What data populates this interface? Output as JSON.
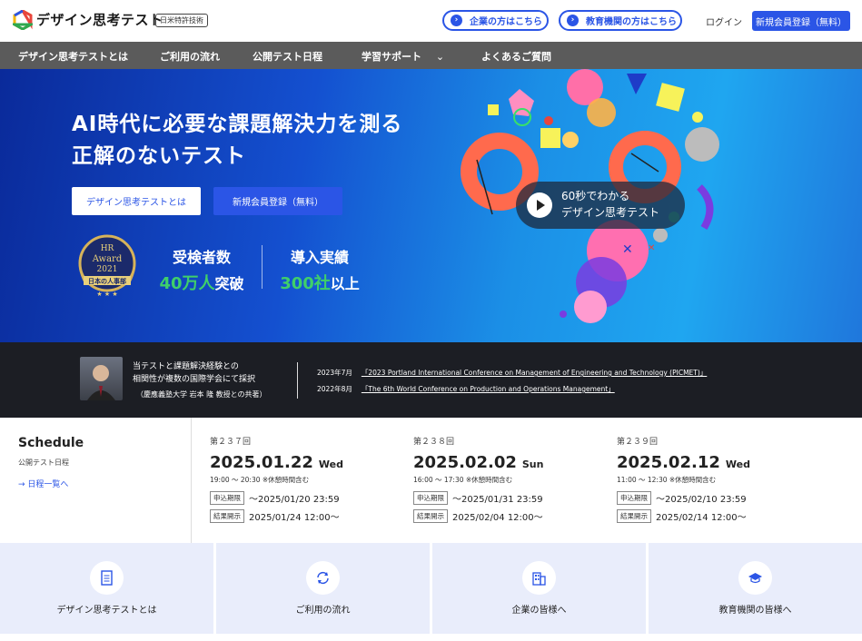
{
  "header": {
    "brand": "デザイン思考テスト",
    "patent_badge": "日米特許技術",
    "corporate_button": "企業の方はこちら",
    "education_button": "教育機関の方はこちら",
    "login": "ログイン",
    "register": "新規会員登録（無料）"
  },
  "nav": {
    "items": [
      {
        "label": "デザイン思考テストとは"
      },
      {
        "label": "ご利用の流れ"
      },
      {
        "label": "公開テスト日程"
      },
      {
        "label": "学習サポート"
      },
      {
        "label": "よくあるご質問"
      }
    ]
  },
  "hero": {
    "title_line1": "AI時代に必要な課題解決力を測る",
    "title_line2": "正解のないテスト",
    "about_button": "デザイン思考テストとは",
    "register_button": "新規会員登録（無料）",
    "award": {
      "line1": "HR",
      "line2": "Award",
      "line3": "2021",
      "ribbon": "日本の人事部"
    },
    "stat1_label": "受検者数",
    "stat1_num": "40万人",
    "stat1_suffix": "突破",
    "stat2_label": "導入実績",
    "stat2_num": "300社",
    "stat2_suffix": "以上",
    "video_line1": "60秒でわかる",
    "video_line2": "デザイン思考テスト"
  },
  "research": {
    "line1": "当テストと課題解決経験との",
    "line2": "相関性が複数の国際学会にて採択",
    "note": "（慶應義塾大学 岩本 隆 教授との共著）",
    "conferences": [
      {
        "date": "2023年7月",
        "title": "「2023 Portland International Conference on Management of Engineering and Technology (PICMET)」"
      },
      {
        "date": "2022年8月",
        "title": "「The 6th World Conference on Production and Operations Management」"
      }
    ]
  },
  "schedule": {
    "title": "Schedule",
    "subtitle": "公開テスト日程",
    "link": "日程一覧へ",
    "deadline_tag": "申込期限",
    "result_tag": "結果開示",
    "events": [
      {
        "round": "第２３７回",
        "date": "2025.01.22",
        "weekday": "Wed",
        "time": "19:00 〜 20:30 ※休憩時間含む",
        "deadline": "〜2025/01/20 23:59",
        "result": "2025/01/24 12:00〜"
      },
      {
        "round": "第２３８回",
        "date": "2025.02.02",
        "weekday": "Sun",
        "time": "16:00 〜 17:30 ※休憩時間含む",
        "deadline": "〜2025/01/31 23:59",
        "result": "2025/02/04 12:00〜"
      },
      {
        "round": "第２３９回",
        "date": "2025.02.12",
        "weekday": "Wed",
        "time": "11:00 〜 12:30 ※休憩時間含む",
        "deadline": "〜2025/02/10 23:59",
        "result": "2025/02/14 12:00〜"
      }
    ]
  },
  "tiles": [
    {
      "label": "デザイン思考テストとは",
      "icon": "document-icon"
    },
    {
      "label": "ご利用の流れ",
      "icon": "refresh-icon"
    },
    {
      "label": "企業の皆様へ",
      "icon": "building-icon"
    },
    {
      "label": "教育機関の皆様へ",
      "icon": "graduation-cap-icon"
    }
  ],
  "colors": {
    "accent": "#2b55e6",
    "nav_bg": "#5b5b5b",
    "stat_green": "#3fcf6a",
    "tile_bg": "#e9edfb"
  }
}
